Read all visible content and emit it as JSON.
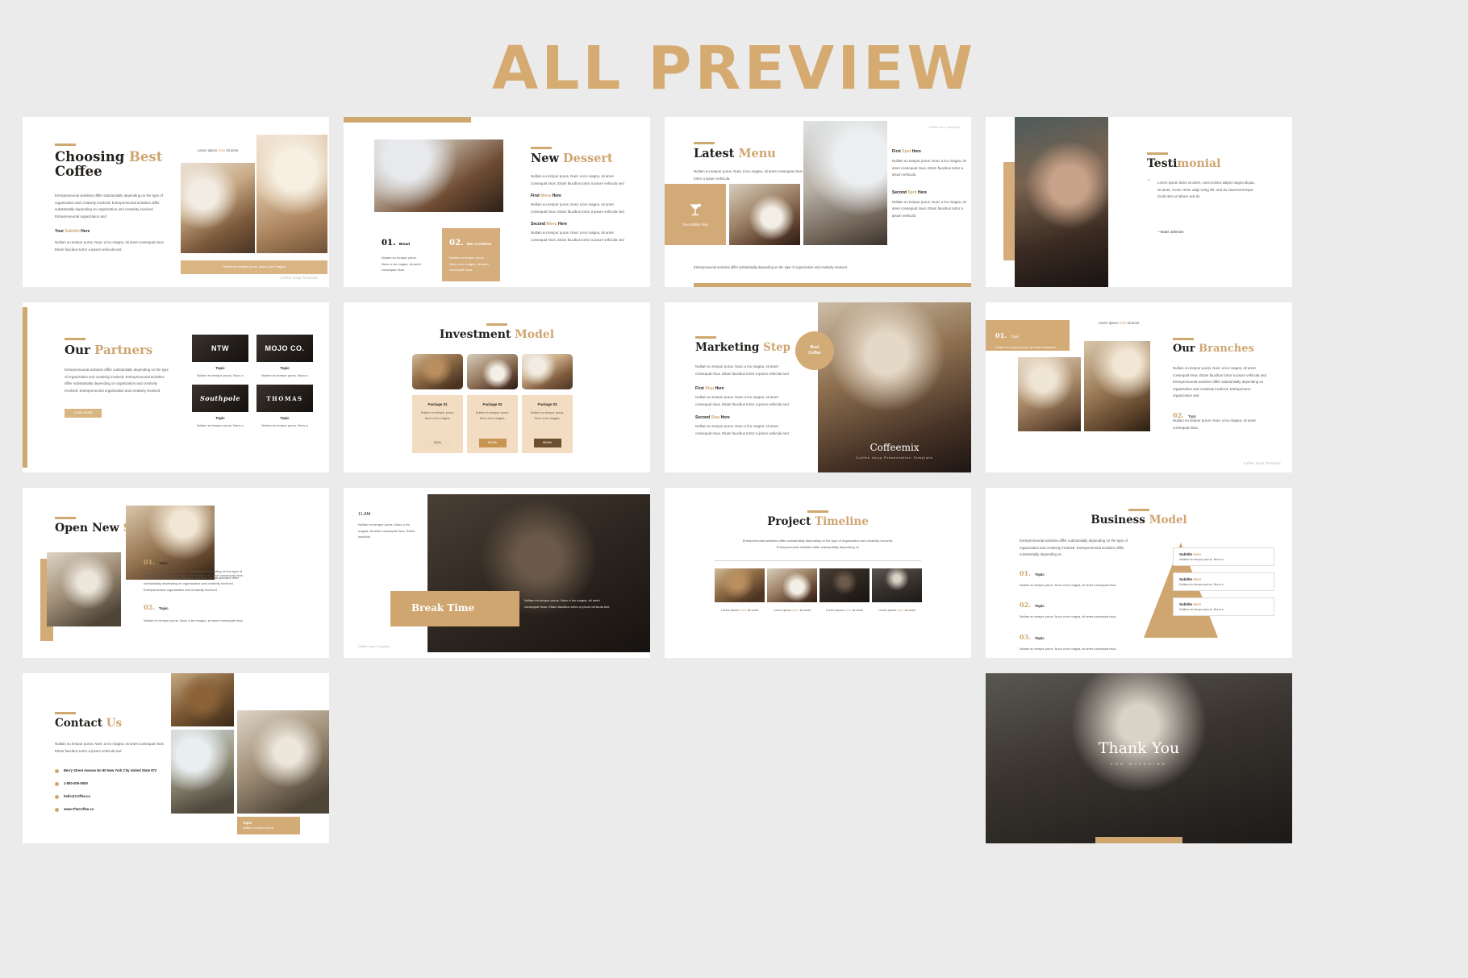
{
  "header": {
    "title": "ALL PREVIEW",
    "accent_color": "#d6ab72"
  },
  "common": {
    "brand_note": "Coffee shop Template",
    "lorem_short": "Nullam eu tempor purus. Nunc a leo magna, sit amet consequat risus. Etiam faucibus tortor a ipsum vehicula.",
    "lorem_med": "Nullam eu tempor purus. Nunc a leo magna, sit amet consequat risus. Etiam faucibus tortor a ipsum vehicula sed",
    "lorem_long": "Entrepreneurial activities differ substantially depending on the type of organization and creativity involved. Entrepreneurial activities differ substantially depending on organization and creativity involved. Entrepreneurial organization and",
    "topic": "Topic",
    "gold": "#cfa571"
  },
  "slides": [
    {
      "id": "choosing-best-coffee",
      "title_plain": "Choosing ",
      "title_gold": "Best",
      "title_line2": "Coffee",
      "paragraph": "Entrepreneurial activities differ substantially depending on the type of organization and creativity involved. Entrepreneurial activities differ substantially depending on organization and creativity involved. Entrepreneurial organization and",
      "subtitle_a": "Your ",
      "subtitle_b": "Subtitle",
      "subtitle_c": " Here",
      "paragraph2": "Nullam eu tempor purus. Nunc a leo magna, sit amet consequat risus. Etiam faucibus tortor a ipsum vehicula sed",
      "caption_a": "Lorem ipsum ",
      "caption_b": "dolor",
      "caption_c": " sit amet",
      "cta": "Nullam eu tempor purus. Nunc a leo magna",
      "footer": "Coffee shop Template"
    },
    {
      "id": "new-dessert",
      "title_plain": "New ",
      "title_gold": "Dessert",
      "paragraph": "Nullam eu tempor purus. Nunc a leo magna, sit amet consequat risus. Etiam faucibus tortor a ipsum vehicula sed",
      "label1_a": "First ",
      "label1_b": "Menu",
      "label1_c": " Here",
      "label2_a": "Second ",
      "label2_b": "Menu",
      "label2_c": " Here",
      "cards": [
        {
          "num": "01.",
          "name": "Bread",
          "desc": "Nullam eu tempor purus. Nunc a leo magna, sit amet consequat risus."
        },
        {
          "num": "02.",
          "name": "Mec a Cheese",
          "desc": "Nullam eu tempor purus. Nunc a leo magna, sit amet consequat risus."
        }
      ]
    },
    {
      "id": "latest-menu",
      "title_plain": "Latest ",
      "title_gold": "Menu",
      "paragraph": "Nullam eu tempor purus. Nunc a leo magna, sit amet consequat risus. Etiam faucibus tortor a ipsum vehicula.",
      "badge_text": "Your subtitle here",
      "spot1_a": "First ",
      "spot1_b": "Spot",
      "spot1_c": " Here",
      "spot1_desc": "Nullam eu tempor purus. Nunc a leo magna, sit amet consequat risus. Etiam faucibus tortor a ipsum vehicula",
      "spot2_a": "Second ",
      "spot2_b": "Spot",
      "spot2_c": " Here",
      "spot2_desc": "Nullam eu tempor purus. Nunc a leo magna, sit amet consequat risus. Etiam faucibus tortor a ipsum vehicula",
      "footer_para": "Entrepreneurial activities differ substantially depending on the type of organization and creativity involved.",
      "topnote": "Coffee shop Template"
    },
    {
      "id": "testimonial",
      "title_plain": "Testi",
      "title_gold": "monial",
      "quote_mark": "“",
      "quote": "Lorem ipsum dolor sit amet, cons ectetur adipis magna aliqua. sit amet, conse ctetur adipi scing elit. sed do eiusmod tempor incidi dunt ut labore sed do",
      "author": "~ Marie Jahnsen"
    },
    {
      "id": "our-partners",
      "title_plain": "Our ",
      "title_gold": "Partners",
      "paragraph": "Entrepreneurial activities differ substantially depending on the type of organization and creativity involved. Entrepreneurial activities differ substantially depending on organization and creativity involved. Entrepreneurial organization and creativity involved",
      "button": "LEARN MORE",
      "partners": [
        {
          "logo": "NTW",
          "topic": "Topic",
          "desc": "Nullam eu tempor purus. Nunc a"
        },
        {
          "logo": "MOJO CO.",
          "topic": "Topic",
          "desc": "Nullam eu tempor purus. Nunc a"
        },
        {
          "logo": "Southpole",
          "topic": "Topic",
          "desc": "Nullam eu tempor purus. Nunc a"
        },
        {
          "logo": "THOMAS",
          "topic": "Topic",
          "desc": "Nullam eu tempor purus. Nunc a"
        }
      ]
    },
    {
      "id": "investment-model",
      "title_plain": "Investment ",
      "title_gold": "Model",
      "packages": [
        {
          "name": "Package 01",
          "desc": "Nullam eu tempor purus. Nunc a leo magna,",
          "price": "$50k"
        },
        {
          "name": "Package 02",
          "desc": "Nullam eu tempor purus. Nunc a leo magna,",
          "price": "$200k"
        },
        {
          "name": "Package 03",
          "desc": "Nullam eu tempor purus. Nunc a leo magna,",
          "price": "$500k"
        }
      ]
    },
    {
      "id": "marketing-step",
      "title_plain": "Marketing ",
      "title_gold": "Step",
      "paragraph": "Nullam eu tempor purus. Nunc a leo magna, sit amet consequat risus. Etiam faucibus tortor a ipsum vehicula sed",
      "step1_a": "First ",
      "step1_b": "Step",
      "step1_c": " Here",
      "step1_desc": "Nullam eu tempor purus. Nunc a leo magna, sit amet consequat risus. Etiam faucibus tortor a ipsum vehicula sed",
      "step2_a": "Second ",
      "step2_b": "Step",
      "step2_c": " Here",
      "step2_desc": "Nullam eu tempor purus. Nunc a leo magna, sit amet consequat risus. Etiam faucibus tortor a ipsum vehicula sed",
      "badge_line1": "Best",
      "badge_line2": "Coffee",
      "brand": "Coffeemix",
      "brand_sub": "Coffee shop Presentation Template"
    },
    {
      "id": "our-branches",
      "title_plain": "Our ",
      "title_gold": "Branches",
      "badge_num": "01.",
      "badge_topic": "Topic",
      "badge_desc": "Nullam eu tempor purus, sit amet consequat risus",
      "caption_a": "Lorem ipsum ",
      "caption_b": "dolor",
      "caption_c": " sit amet",
      "paragraph": "Nullam eu tempor purus. Nunc a leo magna, sit amet consequat risus. Etiam faucibus tortor a ipsum vehicula sed. Entrepreneurial activities differ substantially depending on organization and creativity involved. Entrepreneur organization and",
      "num2": "02.",
      "topic2": "Topic",
      "desc2": "Nullam eu tempor purus. Nunc a leo magna, sit amet consequat risus.",
      "footer": "Coffee shop Template"
    },
    {
      "id": "open-new-shop",
      "title_plain": "Open New ",
      "title_gold": "Shop",
      "items": [
        {
          "num": "01.",
          "topic": "Topic",
          "desc": "Nullam eu tempor purus. Nunc a leo magna, sit amet consequat risus."
        },
        {
          "num": "02.",
          "topic": "Topic",
          "desc": "Nullam eu tempor purus. Nunc a leo magna, sit amet consequat risus."
        }
      ],
      "long_desc": "Entrepreneurial activities differ substantially depending on the type of organization and creativity involved. Entrepreneurial activities differ substantially depending on organization and creativity involved. Entrepreneurial organization and creativity involved"
    },
    {
      "id": "break-time",
      "time_num": "11.",
      "time_unit": "AM",
      "time_desc": "Nullam eu tempor purus. Nunc a leo magna, sit amet consequat risus. Etiam faucibus.",
      "band_title": "Break Time",
      "right_desc": "Nullam eu tempor purus. Nunc a leo magna, sit amet consequat risus. Etiam faucibus tortor a ipsum vehicula sed",
      "footer": "Coffee shop Template"
    },
    {
      "id": "project-timeline",
      "title_plain": "Project ",
      "title_gold": "Timeline",
      "paragraph1": "Entrepreneurial activities differ substantially depending on the type of organization and creativity involved.",
      "paragraph2": "Entrepreneurial activities differ substantially depending on",
      "steps": [
        {
          "a": "Lorem ipsum ",
          "b": "dolor",
          "c": " sit amet"
        },
        {
          "a": "Lorem ipsum ",
          "b": "dolor",
          "c": " sit amet"
        },
        {
          "a": "Lorem ipsum ",
          "b": "dolor",
          "c": " sit amet"
        },
        {
          "a": "Lorem ipsum ",
          "b": "dolor",
          "c": " sit amet"
        }
      ]
    },
    {
      "id": "business-model",
      "title_plain": "Business ",
      "title_gold": "Model",
      "paragraph": "Entrepreneurial activities differ substantially depending on the type of organization and creativity involved. Entrepreneurial activities differ substantially depending on",
      "items": [
        {
          "num": "01.",
          "topic": "Topic",
          "desc": "Nullam eu tempor purus. Nunc a leo magna, sit amet consequat risus."
        },
        {
          "num": "02.",
          "topic": "Topic",
          "desc": "Nullam eu tempor purus. Nunc a leo magna, sit amet consequat risus."
        },
        {
          "num": "03.",
          "topic": "Topic",
          "desc": "Nullam eu tempor purus. Nunc a leo magna, sit amet consequat risus."
        }
      ],
      "boxes": [
        {
          "title_a": "Subtitle ",
          "title_b": "Here",
          "desc": "Nullam eu tempor purus. Nunc a"
        },
        {
          "title_a": "Subtitle ",
          "title_b": "Here",
          "desc": "Nullam eu tempor purus. Nunc a"
        },
        {
          "title_a": "Subtitle ",
          "title_b": "Here",
          "desc": "Nullam eu tempor purus. Nunc a"
        }
      ]
    },
    {
      "id": "contact-us",
      "title_plain": "Contact ",
      "title_gold": "Us",
      "paragraph": "Nullam eu tempor purus. Nunc a leo magna, sit amet consequat risus. Etiam faucibus tortor a ipsum vehicula sed",
      "contacts": [
        "Berry Street Avenue No 80 New York City United State 872",
        "1-800-000-5000",
        "hello@Coffee.co",
        "www.TheCoffee.co"
      ],
      "gold_box_title": "Topic",
      "gold_box_desc": "Nullam eu tempor purus"
    },
    {
      "id": "thank-you",
      "title": "Thank You",
      "subtitle": "FOR WATCHING"
    }
  ]
}
